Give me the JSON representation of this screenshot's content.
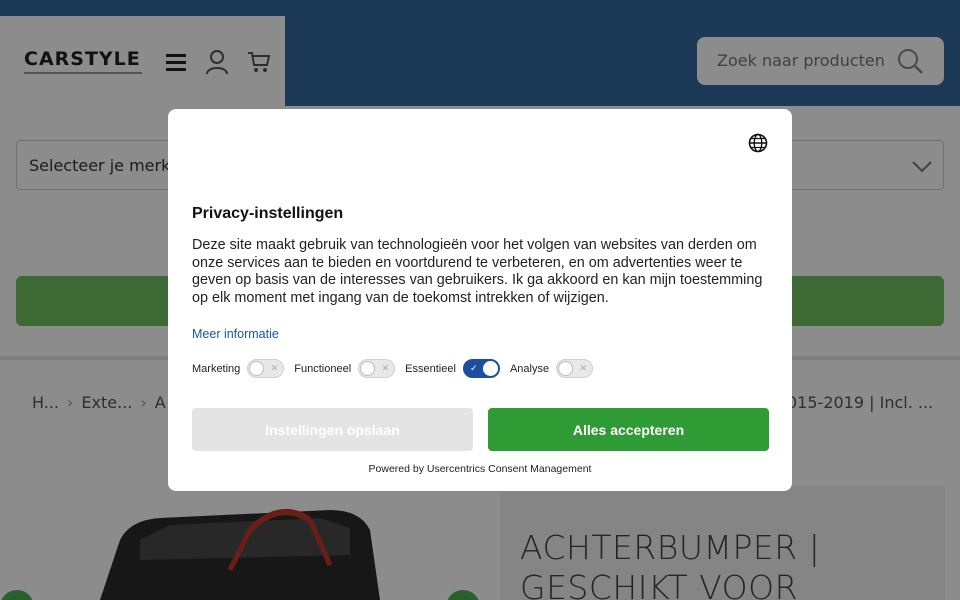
{
  "header": {
    "logo_text": "CARSTYLE",
    "search_placeholder": "Zoek naar producten",
    "menu_icon": "hamburger-icon",
    "account_icon": "user-icon",
    "cart_icon": "cart-icon",
    "search_icon": "search-icon",
    "brand_color": "#336aa0"
  },
  "filters": {
    "brand_select": "Selecteer je merk"
  },
  "breadcrumb": {
    "items": [
      "H...",
      "Exte...",
      "A"
    ],
    "tail": "015-2019 | Incl. ..."
  },
  "product": {
    "title": "ACHTERBUMPER | GESCHIKT VOOR"
  },
  "consent": {
    "title": "Privacy-instellingen",
    "description": "Deze site maakt gebruik van technologieën voor het volgen van websites van derden om onze services aan te bieden en voortdurend te verbeteren, en om advertenties weer te geven op basis van de interesses van gebruikers. Ik ga akkoord en kan mijn toestemming op elk moment met ingang van de toekomst intrekken of wijzigen.",
    "more_info": "Meer informatie",
    "toggles": [
      {
        "label": "Marketing",
        "on": false
      },
      {
        "label": "Functioneel",
        "on": false
      },
      {
        "label": "Essentieel",
        "on": true
      },
      {
        "label": "Analyse",
        "on": false
      }
    ],
    "save_button": "Instellingen opslaan",
    "accept_button": "Alles accepteren",
    "powered_by": "Powered by Usercentrics Consent Management",
    "accept_color": "#2e9b34",
    "toggle_on_color": "#1c4fa0"
  }
}
